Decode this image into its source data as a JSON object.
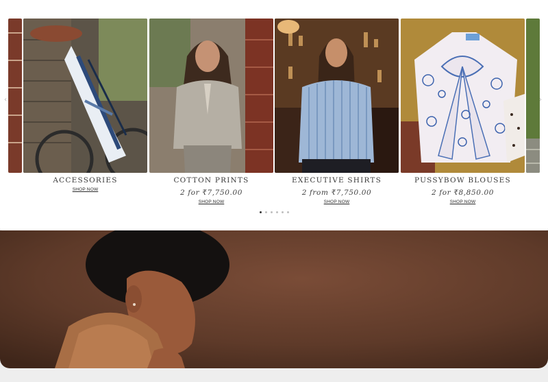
{
  "carousel": {
    "slides": [
      {
        "title": "ACCESSORIES",
        "price": "",
        "cta": "SHOP NOW"
      },
      {
        "title": "COTTON PRINTS",
        "price": "2 for ₹7,750.00",
        "cta": "SHOP NOW"
      },
      {
        "title": "EXECUTIVE SHIRTS",
        "price": "2 from ₹7,750.00",
        "cta": "SHOP NOW"
      },
      {
        "title": "PUSSYBOW BLOUSES",
        "price": "2 for ₹8,850.00",
        "cta": "SHOP NOW"
      }
    ],
    "prev_icon": "‹",
    "next_icon": "›",
    "dot_count": 6,
    "active_dot": 1
  },
  "colors": {
    "hero_brown": "#6b4230",
    "caption_text": "#3a3a3a"
  }
}
